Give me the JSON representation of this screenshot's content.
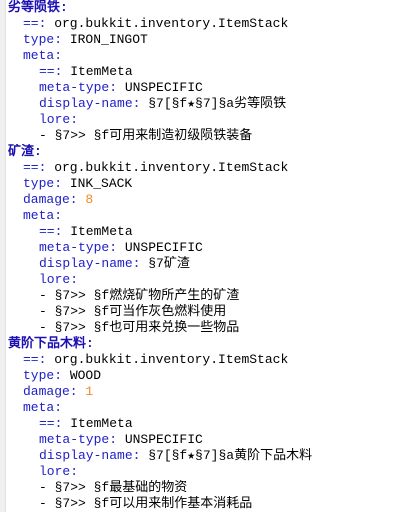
{
  "lines": [
    {
      "indent": 0,
      "key": "劣等陨铁:",
      "head": true
    },
    {
      "indent": 1,
      "key": "==:",
      "value": " org.bukkit.inventory.ItemStack"
    },
    {
      "indent": 1,
      "key": "type:",
      "value": " IRON_INGOT"
    },
    {
      "indent": 1,
      "key": "meta:"
    },
    {
      "indent": 2,
      "key": "==:",
      "value": " ItemMeta"
    },
    {
      "indent": 2,
      "key": "meta-type:",
      "value": " UNSPECIFIC"
    },
    {
      "indent": 2,
      "key": "display-name:",
      "value": " §7[§f★§7]§a劣等陨铁"
    },
    {
      "indent": 2,
      "key": "lore:"
    },
    {
      "indent": 2,
      "value": "- §7>> §f可用来制造初级陨铁装备"
    },
    {
      "indent": 0,
      "key": "矿渣:",
      "head": true
    },
    {
      "indent": 1,
      "key": "==:",
      "value": " org.bukkit.inventory.ItemStack"
    },
    {
      "indent": 1,
      "key": "type:",
      "value": " INK_SACK"
    },
    {
      "indent": 1,
      "key": "damage:",
      "number": "8"
    },
    {
      "indent": 1,
      "key": "meta:"
    },
    {
      "indent": 2,
      "key": "==:",
      "value": " ItemMeta"
    },
    {
      "indent": 2,
      "key": "meta-type:",
      "value": " UNSPECIFIC"
    },
    {
      "indent": 2,
      "key": "display-name:",
      "value": " §7矿渣"
    },
    {
      "indent": 2,
      "key": "lore:"
    },
    {
      "indent": 2,
      "value": "- §7>> §f燃烧矿物所产生的矿渣"
    },
    {
      "indent": 2,
      "value": "- §7>> §f可当作灰色燃料使用"
    },
    {
      "indent": 2,
      "value": "- §7>> §f也可用来兑换一些物品"
    },
    {
      "indent": 0,
      "key": "黄阶下品木料:",
      "head": true
    },
    {
      "indent": 1,
      "key": "==:",
      "value": " org.bukkit.inventory.ItemStack"
    },
    {
      "indent": 1,
      "key": "type:",
      "value": " WOOD"
    },
    {
      "indent": 1,
      "key": "damage:",
      "number": "1"
    },
    {
      "indent": 1,
      "key": "meta:"
    },
    {
      "indent": 2,
      "key": "==:",
      "value": " ItemMeta"
    },
    {
      "indent": 2,
      "key": "meta-type:",
      "value": " UNSPECIFIC"
    },
    {
      "indent": 2,
      "key": "display-name:",
      "value": " §7[§f★§7]§a黄阶下品木料"
    },
    {
      "indent": 2,
      "key": "lore:"
    },
    {
      "indent": 2,
      "value": "- §7>> §f最基础的物资"
    },
    {
      "indent": 2,
      "value": "- §7>> §f可以用来制作基本消耗品"
    }
  ],
  "colors": {
    "key": "#2020c8",
    "head_key": "#1c10b0",
    "number": "#f08a24",
    "text": "#000000",
    "background": "#ffffff"
  }
}
